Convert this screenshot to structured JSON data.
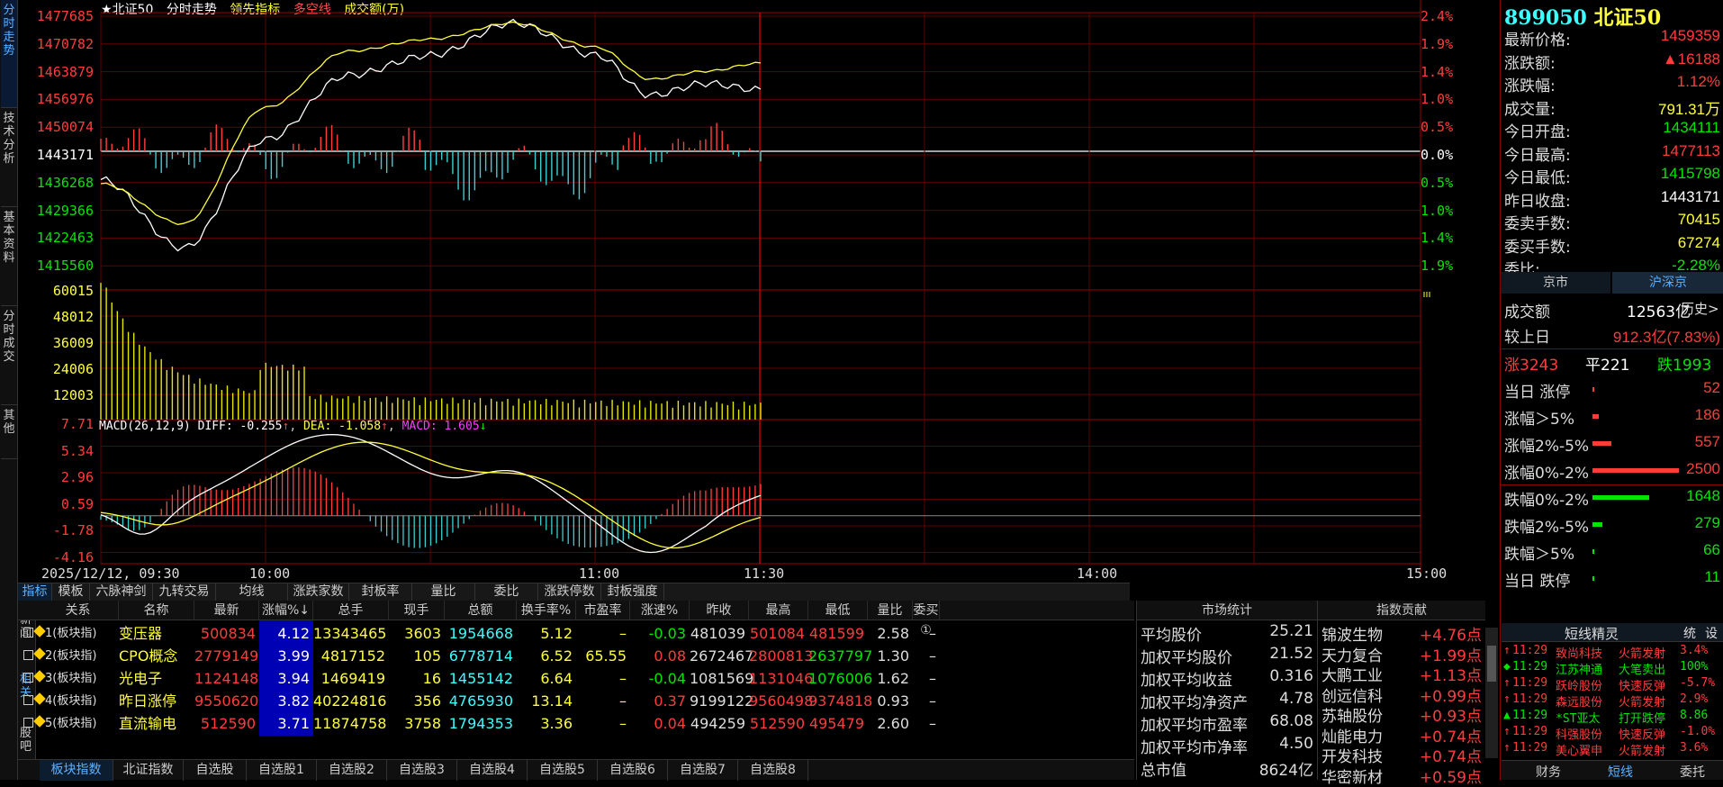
{
  "rail": [
    "分时走势",
    "技术分析",
    "基本资料",
    "分时成交",
    "其他"
  ],
  "header": {
    "index_name": "★北证50",
    "chart_name": "分时走势",
    "lead_label": "领先指标",
    "longshort_label": "多空线",
    "volume_label": "成交额(万)"
  },
  "price_ticks": [
    "1477685",
    "1470782",
    "1463879",
    "1456976",
    "1450074",
    "1443171",
    "1436268",
    "1429366",
    "1422463",
    "1415560"
  ],
  "pct_ticks": [
    "2.4%",
    "1.9%",
    "1.4%",
    "1.0%",
    "0.5%",
    "0.0%",
    "0.5%",
    "1.0%",
    "1.4%",
    "1.9%"
  ],
  "volume_ticks": [
    "60015",
    "48012",
    "36009",
    "24006",
    "12003"
  ],
  "macd": {
    "legend_prefix": "MACD(26,12,9)",
    "diff": "DIFF: -0.255",
    "dea": "DEA: -1.058",
    "macd": "MACD: 1.605",
    "ticks": [
      "7.71",
      "5.34",
      "2.96",
      "0.59",
      "-1.78",
      "-4.16"
    ]
  },
  "time_ticks": [
    "2025/12/12, 09:30",
    "10:00",
    "11:00",
    "11:30",
    "14:00",
    "15:00"
  ],
  "right_panel": {
    "code": "899050",
    "name": "北证50",
    "rows": [
      {
        "label": "最新价格:",
        "value": "1459359",
        "color": "red"
      },
      {
        "label": "涨跌额:",
        "value": "▲16188",
        "color": "red"
      },
      {
        "label": "涨跌幅:",
        "value": "1.12%",
        "color": "red"
      },
      {
        "label": "成交量:",
        "value": "791.31万",
        "color": "yellow"
      },
      {
        "label": "今日开盘:",
        "value": "1434111",
        "color": "green"
      },
      {
        "label": "今日最高:",
        "value": "1477113",
        "color": "red"
      },
      {
        "label": "今日最低:",
        "value": "1415798",
        "color": "green"
      },
      {
        "label": "昨日收盘:",
        "value": "1443171",
        "color": "white"
      },
      {
        "label": "委卖手数:",
        "value": "70415",
        "color": "yellow"
      },
      {
        "label": "委买手数:",
        "value": "67274",
        "color": "yellow"
      },
      {
        "label": "委比:",
        "value": "-2.28%",
        "color": "green"
      }
    ],
    "market_tabs": [
      "京市",
      "沪深京"
    ],
    "turnover_label": "成交额",
    "turnover_value": "12563亿",
    "history_label": "历史>",
    "prev_day_label": "较上日",
    "prev_day_value": "912.3亿(7.83%)",
    "up_label": "涨3243",
    "flat_label": "平221",
    "down_label": "跌1993",
    "dist": [
      {
        "label": "当日 涨停",
        "value": "52",
        "color": "#ff3c3c",
        "level": 0.01,
        "val_color": "red"
      },
      {
        "label": "涨幅＞5%",
        "value": "186",
        "color": "#ff3c3c",
        "level": 0.07,
        "val_color": "red"
      },
      {
        "label": "涨幅2%-5%",
        "value": "557",
        "color": "#ff3c3c",
        "level": 0.22,
        "val_color": "red"
      },
      {
        "label": "涨幅0%-2%",
        "value": "2500",
        "color": "#ff3c3c",
        "level": 1.0,
        "val_color": "red"
      },
      {
        "label": "跌幅0%-2%",
        "value": "1648",
        "color": "#00e600",
        "level": 0.66,
        "val_color": "green"
      },
      {
        "label": "跌幅2%-5%",
        "value": "279",
        "color": "#00e600",
        "level": 0.11,
        "val_color": "green"
      },
      {
        "label": "跌幅＞5%",
        "value": "66",
        "color": "#00e600",
        "level": 0.01,
        "val_color": "green"
      },
      {
        "label": "当日 跌停",
        "value": "11",
        "color": "#00e600",
        "level": 0.0,
        "val_color": "green"
      }
    ],
    "shortline_title": "短线精灵",
    "shortline_tabs": [
      "统",
      "设"
    ],
    "shortline": [
      {
        "arrow": "↑",
        "time": "11:29",
        "name": "致尚科技",
        "event": "火箭发射",
        "pct": "3.4%",
        "color": "red"
      },
      {
        "arrow": "◆",
        "time": "11:29",
        "name": "江苏神通",
        "event": "大笔卖出",
        "pct": "100%",
        "color": "green"
      },
      {
        "arrow": "↑",
        "time": "11:29",
        "name": "跃岭股份",
        "event": "快速反弹",
        "pct": "-5.7%",
        "color": "red"
      },
      {
        "arrow": "↑",
        "time": "11:29",
        "name": "森远股份",
        "event": "火箭发射",
        "pct": "2.9%",
        "color": "red"
      },
      {
        "arrow": "▲",
        "time": "11:29",
        "name": "*ST亚太",
        "event": "打开跌停",
        "pct": "8.86",
        "color": "green"
      },
      {
        "arrow": "↑",
        "time": "11:29",
        "name": "科强股份",
        "event": "快速反弹",
        "pct": "-1.0%",
        "color": "red"
      },
      {
        "arrow": "↑",
        "time": "11:29",
        "name": "美心翼申",
        "event": "火箭发射",
        "pct": "3.6%",
        "color": "red"
      }
    ],
    "bottom_tabs": [
      "财务",
      "短线",
      "委托"
    ]
  },
  "table_tabs": [
    "指标",
    "模板",
    "六脉神剑",
    "九转交易",
    "均线",
    "涨跌家数",
    "封板率",
    "量比",
    "委比",
    "涨跌停数",
    "封板强度"
  ],
  "table_side": [
    "新闻",
    "相关",
    "股吧"
  ],
  "table_headers": [
    "关系",
    "名称",
    "最新",
    "涨幅%↓",
    "总手",
    "现手",
    "总额",
    "换手率%",
    "市盈率",
    "涨速%",
    "昨收",
    "最高",
    "最低",
    "量比",
    "委买①"
  ],
  "table_rows": [
    [
      "1(板块指)",
      "变压器",
      "500834",
      "4.12",
      "13343465",
      "3603",
      "1954668",
      "5.12",
      "–",
      "-0.03",
      "481039",
      "501084",
      "481599",
      "2.58",
      "–"
    ],
    [
      "2(板块指)",
      "CPO概念",
      "2779149",
      "3.99",
      "4817152",
      "105",
      "6778714",
      "6.52",
      "65.55",
      "0.08",
      "2672467",
      "2800813",
      "2637797",
      "1.30",
      "–"
    ],
    [
      "3(板块指)",
      "光电子",
      "1124148",
      "3.94",
      "1469419",
      "16",
      "1455142",
      "6.64",
      "–",
      "-0.04",
      "1081569",
      "1131046",
      "1076006",
      "1.62",
      "–"
    ],
    [
      "4(板块指)",
      "昨日涨停",
      "9550620",
      "3.82",
      "40224816",
      "356",
      "4765930",
      "13.14",
      "–",
      "0.37",
      "9199122",
      "9560498",
      "9374818",
      "0.93",
      "–"
    ],
    [
      "5(板块指)",
      "直流输电",
      "512590",
      "3.71",
      "11874758",
      "3758",
      "1794353",
      "3.36",
      "–",
      "0.04",
      "494259",
      "512590",
      "495479",
      "2.60",
      "–"
    ]
  ],
  "stats": {
    "title": "市场统计",
    "rows": [
      {
        "label": "平均股价",
        "value": "25.21"
      },
      {
        "label": "加权平均股价",
        "value": "21.52"
      },
      {
        "label": "加权平均收益",
        "value": "0.316"
      },
      {
        "label": "加权平均净资产",
        "value": "4.78"
      },
      {
        "label": "加权平均市盈率",
        "value": "68.08"
      },
      {
        "label": "加权平均市净率",
        "value": "4.50"
      },
      {
        "label": "总市值",
        "value": "8624亿"
      }
    ]
  },
  "contrib": {
    "title": "指数贡献",
    "rows": [
      {
        "name": "锦波生物",
        "value": "+4.76点"
      },
      {
        "name": "天力复合",
        "value": "+1.99点"
      },
      {
        "name": "大鹏工业",
        "value": "+1.13点"
      },
      {
        "name": "创远信科",
        "value": "+0.99点"
      },
      {
        "name": "苏轴股份",
        "value": "+0.93点"
      },
      {
        "name": "灿能电力",
        "value": "+0.74点"
      },
      {
        "name": "开发科技",
        "value": "+0.74点"
      },
      {
        "name": "华密新材",
        "value": "+0.59点"
      }
    ]
  },
  "bottom_tabs": [
    "板块指数",
    "北证指数",
    "自选股",
    "自选股1",
    "自选股2",
    "自选股3",
    "自选股4",
    "自选股5",
    "自选股6",
    "自选股7",
    "自选股8"
  ],
  "chart_data": {
    "type": "line",
    "x_range": [
      "09:30",
      "15:00"
    ],
    "prev_close": 1443171,
    "series": [
      {
        "name": "分时走势",
        "color": "#ffffff",
        "x": [
          "09:30",
          "09:45",
          "10:00",
          "10:15",
          "10:30",
          "10:45",
          "11:00",
          "11:10",
          "11:20",
          "11:30"
        ],
        "values": [
          1437000,
          1420000,
          1447000,
          1463000,
          1468000,
          1476000,
          1468000,
          1458000,
          1461000,
          1459359
        ]
      },
      {
        "name": "领先指标",
        "color": "#ffff3c",
        "x": [
          "09:30",
          "09:45",
          "10:00",
          "10:15",
          "10:30",
          "10:45",
          "11:00",
          "11:10",
          "11:20",
          "11:30"
        ],
        "values": [
          1436000,
          1426000,
          1455000,
          1469000,
          1472000,
          1476000,
          1470000,
          1462000,
          1464000,
          1466000
        ]
      }
    ],
    "volume_ylim": [
      0,
      60015
    ],
    "macd_ylim": [
      -4.16,
      7.71
    ]
  }
}
